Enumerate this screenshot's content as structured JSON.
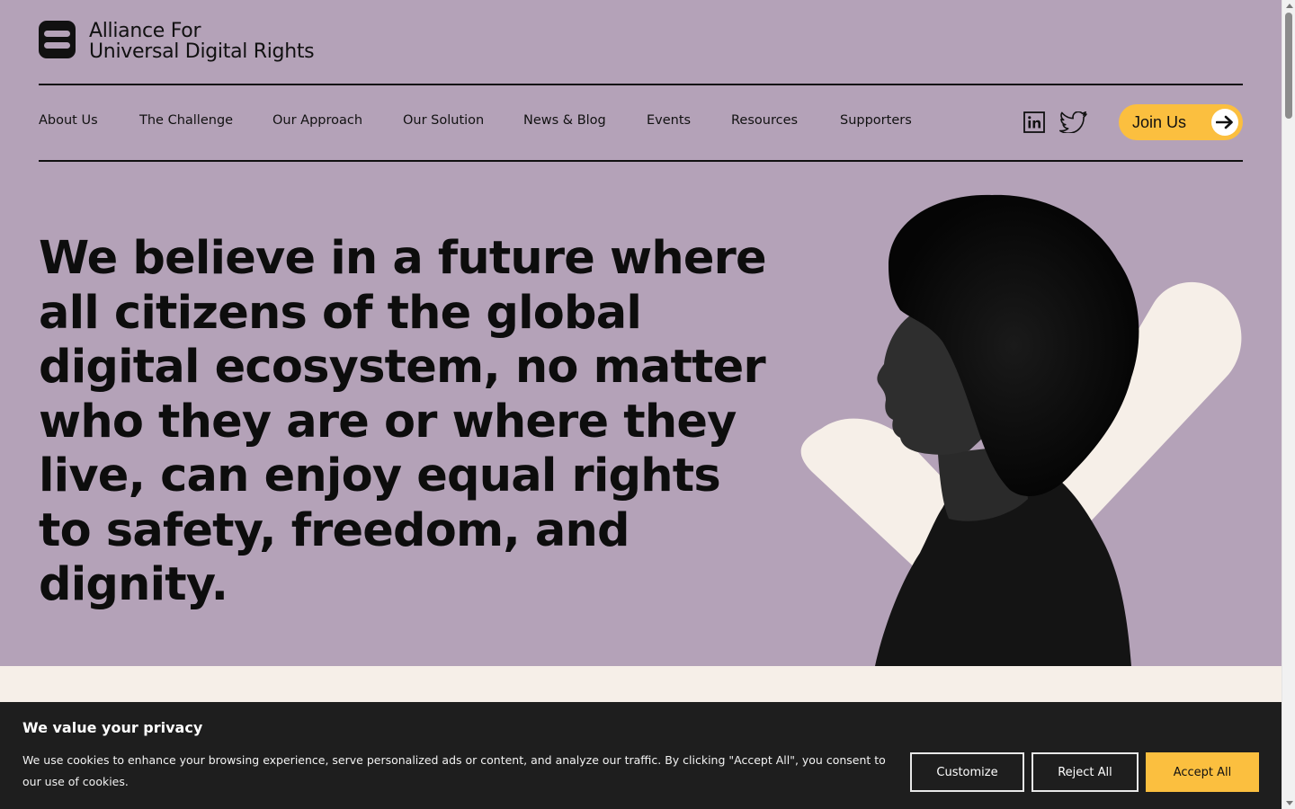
{
  "brand": {
    "line1": "Alliance For",
    "line2": "Universal Digital Rights",
    "logo_icon": "stacked-bars-logo-icon"
  },
  "nav": {
    "items": [
      {
        "label": "About Us"
      },
      {
        "label": "The Challenge"
      },
      {
        "label": "Our Approach"
      },
      {
        "label": "Our Solution"
      },
      {
        "label": "News & Blog"
      },
      {
        "label": "Events"
      },
      {
        "label": "Resources"
      },
      {
        "label": "Supporters"
      }
    ],
    "social": [
      "linkedin-icon",
      "twitter-icon"
    ],
    "cta_label": "Join Us",
    "cta_icon": "arrow-right-icon"
  },
  "hero": {
    "headline": "We believe in a future where all citizens of the global digital ecosystem, no matter who they are or where they live, can enjoy equal rights to safety, freedom, and dignity."
  },
  "cookie_banner": {
    "title": "We value your privacy",
    "text": "We use cookies to enhance your browsing experience, serve personalized ads or content, and analyze our traffic. By clicking \"Accept All\", you consent to our use of cookies.",
    "customize_label": "Customize",
    "reject_label": "Reject All",
    "accept_label": "Accept All"
  },
  "colors": {
    "hero_bg": "#b4a2b8",
    "cream": "#f6efe8",
    "accent": "#fbbf3f",
    "ink": "#111111",
    "banner_bg": "#1e1e1e"
  }
}
